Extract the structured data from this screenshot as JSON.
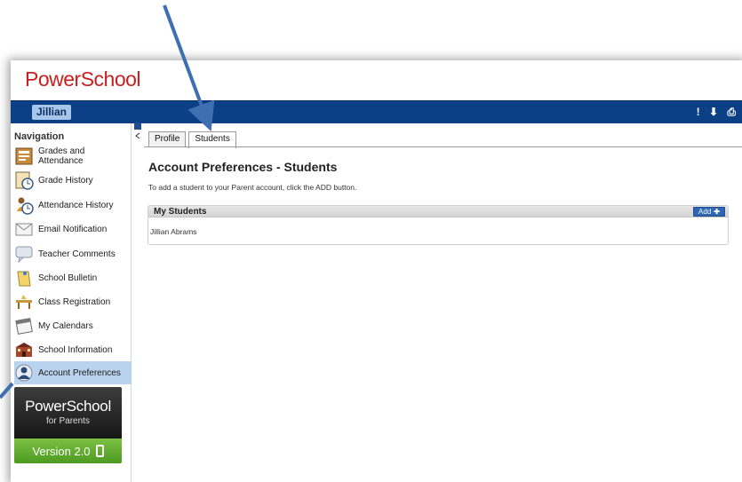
{
  "app": {
    "logo": "PowerSchool"
  },
  "header": {
    "user_name": "Jillian",
    "icons": [
      "!",
      "⬇",
      "⎙"
    ]
  },
  "sidebar": {
    "title": "Navigation",
    "items": [
      {
        "label": "Grades and Attendance",
        "icon": "grades-icon"
      },
      {
        "label": "Grade History",
        "icon": "grade-history-icon"
      },
      {
        "label": "Attendance History",
        "icon": "attendance-history-icon"
      },
      {
        "label": "Email Notification",
        "icon": "email-icon"
      },
      {
        "label": "Teacher Comments",
        "icon": "comments-icon"
      },
      {
        "label": "School Bulletin",
        "icon": "bulletin-icon"
      },
      {
        "label": "Class Registration",
        "icon": "class-registration-icon"
      },
      {
        "label": "My Calendars",
        "icon": "calendar-icon"
      },
      {
        "label": "School Information",
        "icon": "school-icon"
      },
      {
        "label": "Account Preferences",
        "icon": "account-icon"
      }
    ],
    "promo": {
      "brand": "PowerSchool",
      "subtitle": "for Parents",
      "version": "Version 2.0"
    }
  },
  "tabs": [
    {
      "label": "Profile",
      "active": false
    },
    {
      "label": "Students",
      "active": true
    }
  ],
  "main": {
    "title": "Account Preferences - Students",
    "instructions": "To add a student to your Parent account, click the ADD button.",
    "students": {
      "header": "My Students",
      "add_label": "Add",
      "rows": [
        "Jillian Abrams"
      ]
    }
  },
  "colors": {
    "brand_red": "#c8201f",
    "header_blue": "#0b3f86",
    "active_nav": "#b9d3ef",
    "arrow": "#3e6fb0"
  }
}
